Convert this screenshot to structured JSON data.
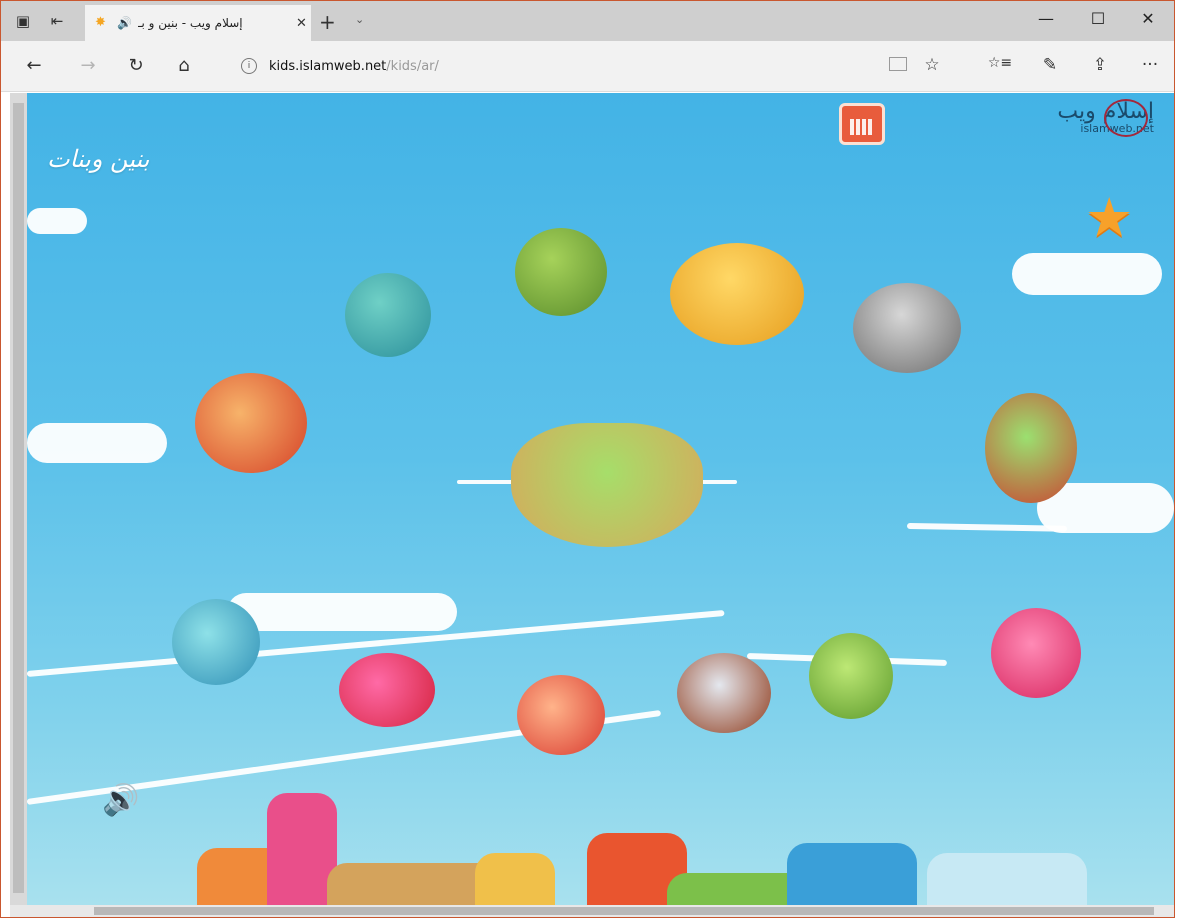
{
  "browser": {
    "tab": {
      "title": "إسلام ويب - بنين و بـ",
      "audio_icon": "🔊",
      "close_label": "✕"
    },
    "new_tab_label": "+",
    "tab_list_chevron": "⌄",
    "window_controls": {
      "minimize": "—",
      "maximize": "☐",
      "close": "✕"
    },
    "nav": {
      "back": "←",
      "forward": "→",
      "refresh": "↻",
      "home": "⌂"
    },
    "address": {
      "info_icon": "i",
      "host": "kids.islamweb.net",
      "path": "/kids/ar/"
    },
    "toolbar_right": {
      "favorite": "☆",
      "favorites_hub": "☆≡",
      "notes": "✎",
      "share": "⇪",
      "more": "···"
    }
  },
  "page": {
    "logo_arabic": "إسلام ويب",
    "logo_english": "islamweb.net",
    "site_name": "بنين وبنات",
    "star_icon": "★",
    "sound_icon": "🔊"
  },
  "colors": {
    "sky_top": "#43b3e6",
    "sky_bottom": "#a8e1ee",
    "calendar": "#e85c3c",
    "star": "#f7a12a",
    "accent_frame": "#c9572f"
  }
}
